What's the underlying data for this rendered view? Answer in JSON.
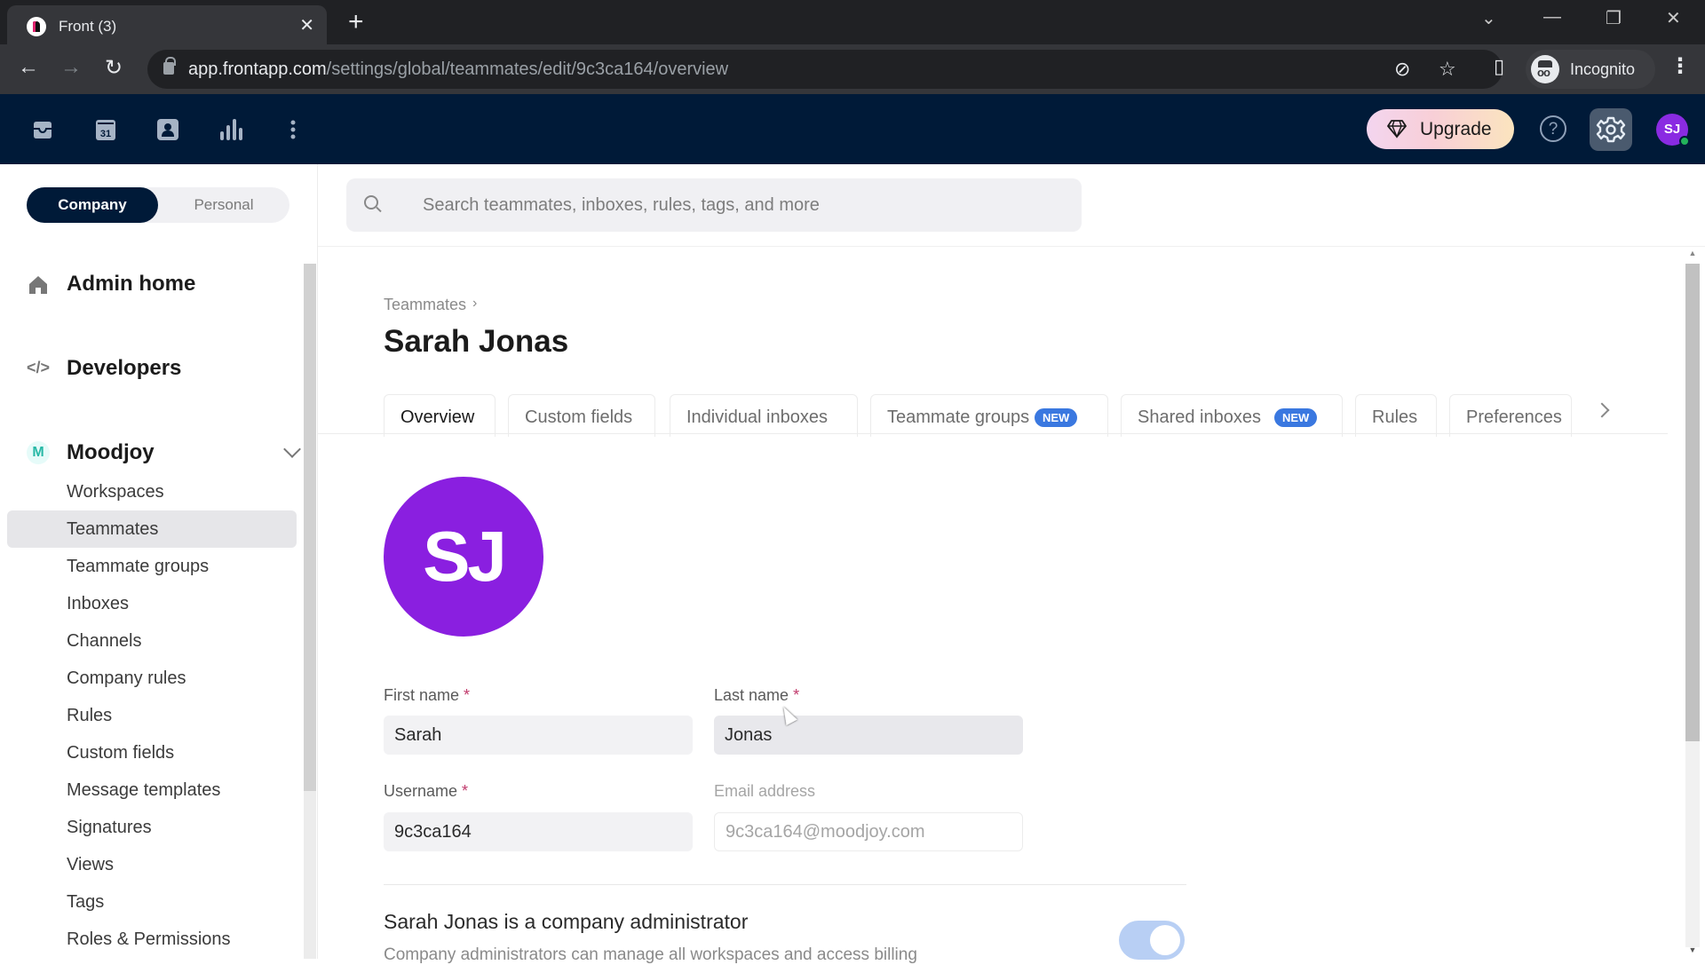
{
  "browser": {
    "tab_title": "Front (3)",
    "url_host": "app.frontapp.com",
    "url_path": "/settings/global/teammates/edit/9c3ca164/overview",
    "profile_label": "Incognito"
  },
  "app_header": {
    "nav_icons": [
      "inbox-icon",
      "calendar-icon",
      "contacts-icon",
      "analytics-icon",
      "more-icon"
    ],
    "calendar_day": "31",
    "upgrade_label": "Upgrade",
    "help_label": "?",
    "user_initials": "SJ",
    "user_status": "online"
  },
  "sidebar": {
    "scope_toggle": {
      "active": "Company",
      "inactive": "Personal"
    },
    "admin_home": "Admin home",
    "developers": "Developers",
    "workspace": {
      "badge": "M",
      "name": "Moodjoy"
    },
    "items": [
      {
        "label": "Workspaces",
        "active": false
      },
      {
        "label": "Teammates",
        "active": true
      },
      {
        "label": "Teammate groups",
        "active": false
      },
      {
        "label": "Inboxes",
        "active": false
      },
      {
        "label": "Channels",
        "active": false
      },
      {
        "label": "Company rules",
        "active": false
      },
      {
        "label": "Rules",
        "active": false
      },
      {
        "label": "Custom fields",
        "active": false
      },
      {
        "label": "Message templates",
        "active": false
      },
      {
        "label": "Signatures",
        "active": false
      },
      {
        "label": "Views",
        "active": false
      },
      {
        "label": "Tags",
        "active": false
      },
      {
        "label": "Roles & Permissions",
        "active": false
      }
    ]
  },
  "main": {
    "search_placeholder": "Search teammates, inboxes, rules, tags, and more",
    "breadcrumb": "Teammates",
    "title": "Sarah Jonas",
    "tabs": [
      {
        "label": "Overview",
        "active": true,
        "badge": ""
      },
      {
        "label": "Custom fields",
        "active": false,
        "badge": ""
      },
      {
        "label": "Individual inboxes",
        "active": false,
        "badge": ""
      },
      {
        "label": "Teammate groups",
        "active": false,
        "badge": "NEW"
      },
      {
        "label": "Shared inboxes",
        "active": false,
        "badge": "NEW"
      },
      {
        "label": "Rules",
        "active": false,
        "badge": ""
      },
      {
        "label": "Preferences",
        "active": false,
        "badge": ""
      }
    ],
    "avatar_initials": "SJ",
    "form": {
      "first_name": {
        "label": "First name",
        "required": "*",
        "value": "Sarah"
      },
      "last_name": {
        "label": "Last name",
        "required": "*",
        "value": "Jonas"
      },
      "username": {
        "label": "Username",
        "required": "*",
        "value": "9c3ca164"
      },
      "email": {
        "label": "Email address",
        "value": "9c3ca164@moodjoy.com"
      }
    },
    "admin": {
      "title": "Sarah Jonas is a company administrator",
      "description": "Company administrators can manage all workspaces and access billing",
      "enabled": true
    }
  },
  "colors": {
    "header_bg": "#001a38",
    "avatar": "#8a1fe0",
    "badge_new": "#3a78e0",
    "required": "#c0396b",
    "toggle_on": "#b8cff4"
  }
}
